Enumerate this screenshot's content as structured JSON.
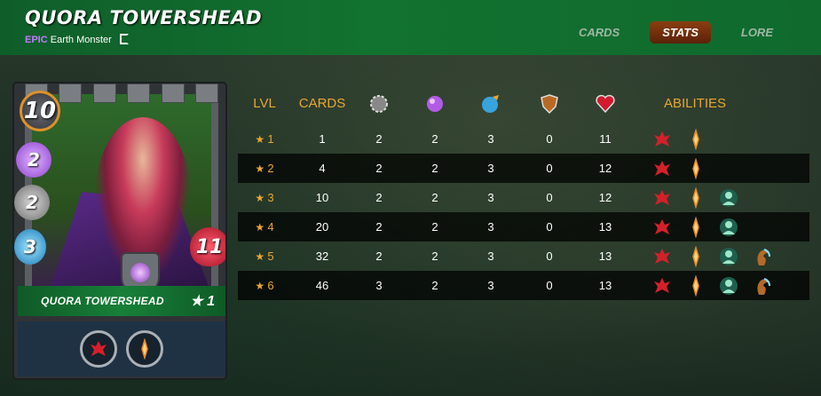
{
  "header": {
    "title": "QUORA TOWERSHEAD",
    "rarity": "EPIC",
    "subtitle": "Earth Monster",
    "tabs": [
      {
        "label": "CARDS",
        "active": false
      },
      {
        "label": "STATS",
        "active": true
      },
      {
        "label": "LORE",
        "active": false
      }
    ]
  },
  "card": {
    "name": "QUORA TOWERSHEAD",
    "level_label": "★ 1",
    "mana": "10",
    "magic": "2",
    "melee": "2",
    "speed": "3",
    "health": "11",
    "abilities": [
      "enrage-icon",
      "divine-shield-icon"
    ]
  },
  "table": {
    "headers": {
      "lvl": "LVL",
      "cards": "CARDS",
      "abilities": "ABILITIES",
      "icons": [
        "melee-attack-icon",
        "magic-attack-icon",
        "speed-icon",
        "armor-icon",
        "health-icon"
      ]
    },
    "rows": [
      {
        "lvl": "1",
        "cards": "1",
        "melee": "2",
        "magic": "2",
        "speed": "3",
        "armor": "0",
        "health": "11",
        "abilities": [
          "enrage-icon",
          "divine-shield-icon"
        ]
      },
      {
        "lvl": "2",
        "cards": "4",
        "melee": "2",
        "magic": "2",
        "speed": "3",
        "armor": "0",
        "health": "12",
        "abilities": [
          "enrage-icon",
          "divine-shield-icon"
        ]
      },
      {
        "lvl": "3",
        "cards": "10",
        "melee": "2",
        "magic": "2",
        "speed": "3",
        "armor": "0",
        "health": "12",
        "abilities": [
          "enrage-icon",
          "divine-shield-icon",
          "inspire-icon"
        ]
      },
      {
        "lvl": "4",
        "cards": "20",
        "melee": "2",
        "magic": "2",
        "speed": "3",
        "armor": "0",
        "health": "13",
        "abilities": [
          "enrage-icon",
          "divine-shield-icon",
          "inspire-icon"
        ]
      },
      {
        "lvl": "5",
        "cards": "32",
        "melee": "2",
        "magic": "2",
        "speed": "3",
        "armor": "0",
        "health": "13",
        "abilities": [
          "enrage-icon",
          "divine-shield-icon",
          "inspire-icon",
          "strengthen-icon"
        ]
      },
      {
        "lvl": "6",
        "cards": "46",
        "melee": "3",
        "magic": "2",
        "speed": "3",
        "armor": "0",
        "health": "13",
        "abilities": [
          "enrage-icon",
          "divine-shield-icon",
          "inspire-icon",
          "strengthen-icon"
        ]
      }
    ]
  },
  "colors": {
    "accent_orange": "#e9a632",
    "header_green": "#12722f",
    "epic_purple": "#c07cff",
    "active_tab": "#7a3410"
  }
}
